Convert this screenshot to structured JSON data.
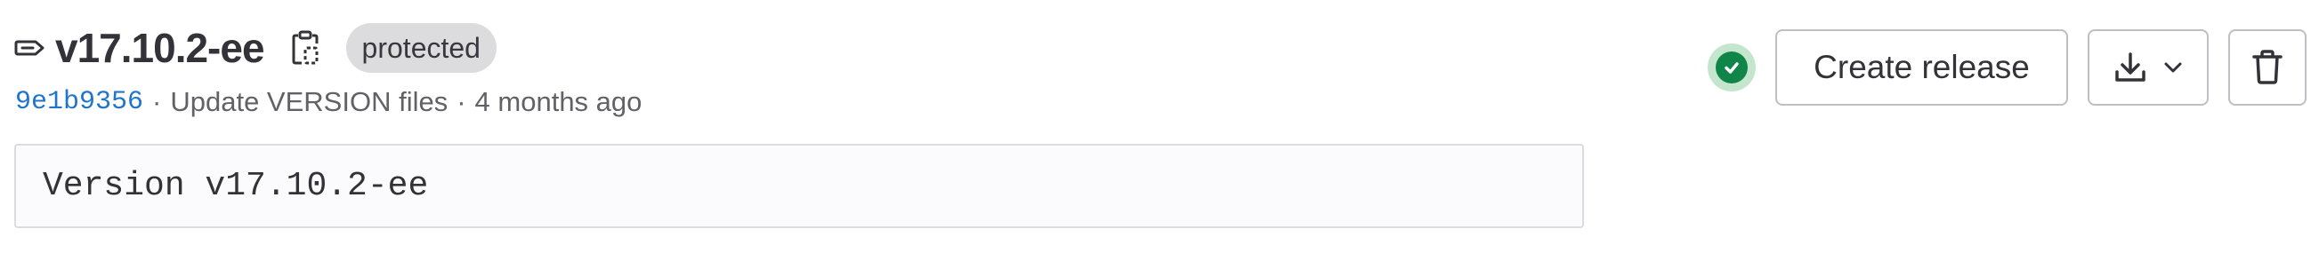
{
  "tag": {
    "name": "v17.10.2-ee",
    "protected_badge": "protected",
    "commit": {
      "sha": "9e1b9356",
      "separator": "·",
      "message": "Update VERSION files",
      "age": "4 months ago"
    },
    "message": "Version v17.10.2-ee"
  },
  "actions": {
    "pipeline_status": "success",
    "create_release_label": "Create release"
  },
  "icons": {
    "tag": "tag-icon",
    "copy": "clipboard-icon",
    "status": "check-circle-icon",
    "download": "download-icon",
    "chevron": "chevron-down-icon",
    "delete": "trash-icon"
  },
  "colors": {
    "text": "#333238",
    "muted": "#626168",
    "link": "#1f75cb",
    "badge_bg": "#dcdcde",
    "success": "#108548",
    "success_ring": "#c3e6cd",
    "border": "#bfbfc3"
  }
}
